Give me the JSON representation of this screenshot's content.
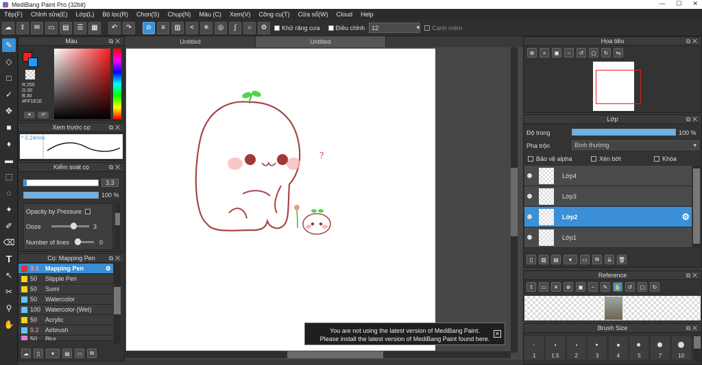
{
  "window": {
    "title": "MediBang Paint Pro (32bit)",
    "min": "—",
    "max": "☐",
    "close": "✕"
  },
  "menu": [
    "Tệp(F)",
    "Chỉnh sửa(E)",
    "Lớp(L)",
    "Bộ lọc(R)",
    "Chọn(S)",
    "Chụp(N)",
    "Màu (C)",
    "Xem(V)",
    "Công cụ(T)",
    "Cửa sổ(W)",
    "Cloud",
    "Help"
  ],
  "toolbar": {
    "antialias_label": "Khử răng cưa",
    "correction_label": "Điều chỉnh",
    "correction_value": "12",
    "snap_label": "Cạnh mềm"
  },
  "color_panel": {
    "title": "Màu",
    "r": "R:255",
    "g": "G:30",
    "b": "B:30",
    "hex": "#FF1E1E",
    "primary_color": "#FF1E1E",
    "secondary_color": "#1E9BFF"
  },
  "brush_preview": {
    "title": "Xem trước cọ",
    "size": "0.24mm"
  },
  "brush_control": {
    "title": "Kiểm soát cọ",
    "size_value": "3.3",
    "opacity_value": "100",
    "opacity_unit": "%",
    "opacity_pressure_label": "Opacity by Pressure",
    "ooze_label": "Ooze",
    "ooze_value": "3",
    "lines_label": "Number of lines",
    "lines_value": "0"
  },
  "brushes": {
    "title": "Cọ: Mapping Pen",
    "items": [
      {
        "size": "3.3",
        "name": "Mapping Pen",
        "color": "#e03030",
        "selected": true
      },
      {
        "size": "50",
        "name": "Stipple Pen",
        "color": "#f2d21a"
      },
      {
        "size": "50",
        "name": "Sumi",
        "color": "#f2d21a"
      },
      {
        "size": "50",
        "name": "Watercolor",
        "color": "#5ec8f0"
      },
      {
        "size": "100",
        "name": "Watercolor (Wet)",
        "color": "#5ec8f0"
      },
      {
        "size": "50",
        "name": "Acrylic",
        "color": "#f2d21a"
      },
      {
        "size": "9.2",
        "name": "Airbrush",
        "color": "#5ec8f0"
      },
      {
        "size": "50",
        "name": "Blur",
        "color": "#e07ad8"
      }
    ]
  },
  "tabs": [
    "Untitled",
    "Untitled"
  ],
  "notice": {
    "line1": "You are not using the latest version of MediBang Paint.",
    "line2": "Please install the latest version of MediBang Paint found here."
  },
  "navigator": {
    "title": "Hoa tiêu"
  },
  "layers": {
    "title": "Lớp",
    "opacity_label": "Độ trong",
    "opacity_value": "100 %",
    "blend_label": "Pha trộn",
    "blend_value": "Bình thường",
    "protect_alpha": "Bảo vệ alpha",
    "clipping": "Xén bớt",
    "lock": "Khóa",
    "items": [
      {
        "name": "Lớp4",
        "selected": false
      },
      {
        "name": "Lớp3",
        "selected": false
      },
      {
        "name": "Lớp2",
        "selected": true
      },
      {
        "name": "Lớp1",
        "selected": false
      }
    ]
  },
  "reference": {
    "title": "Reference"
  },
  "brush_size": {
    "title": "Brush Size",
    "sizes": [
      "1",
      "1.5",
      "2",
      "3",
      "4",
      "5",
      "7",
      "10"
    ]
  }
}
